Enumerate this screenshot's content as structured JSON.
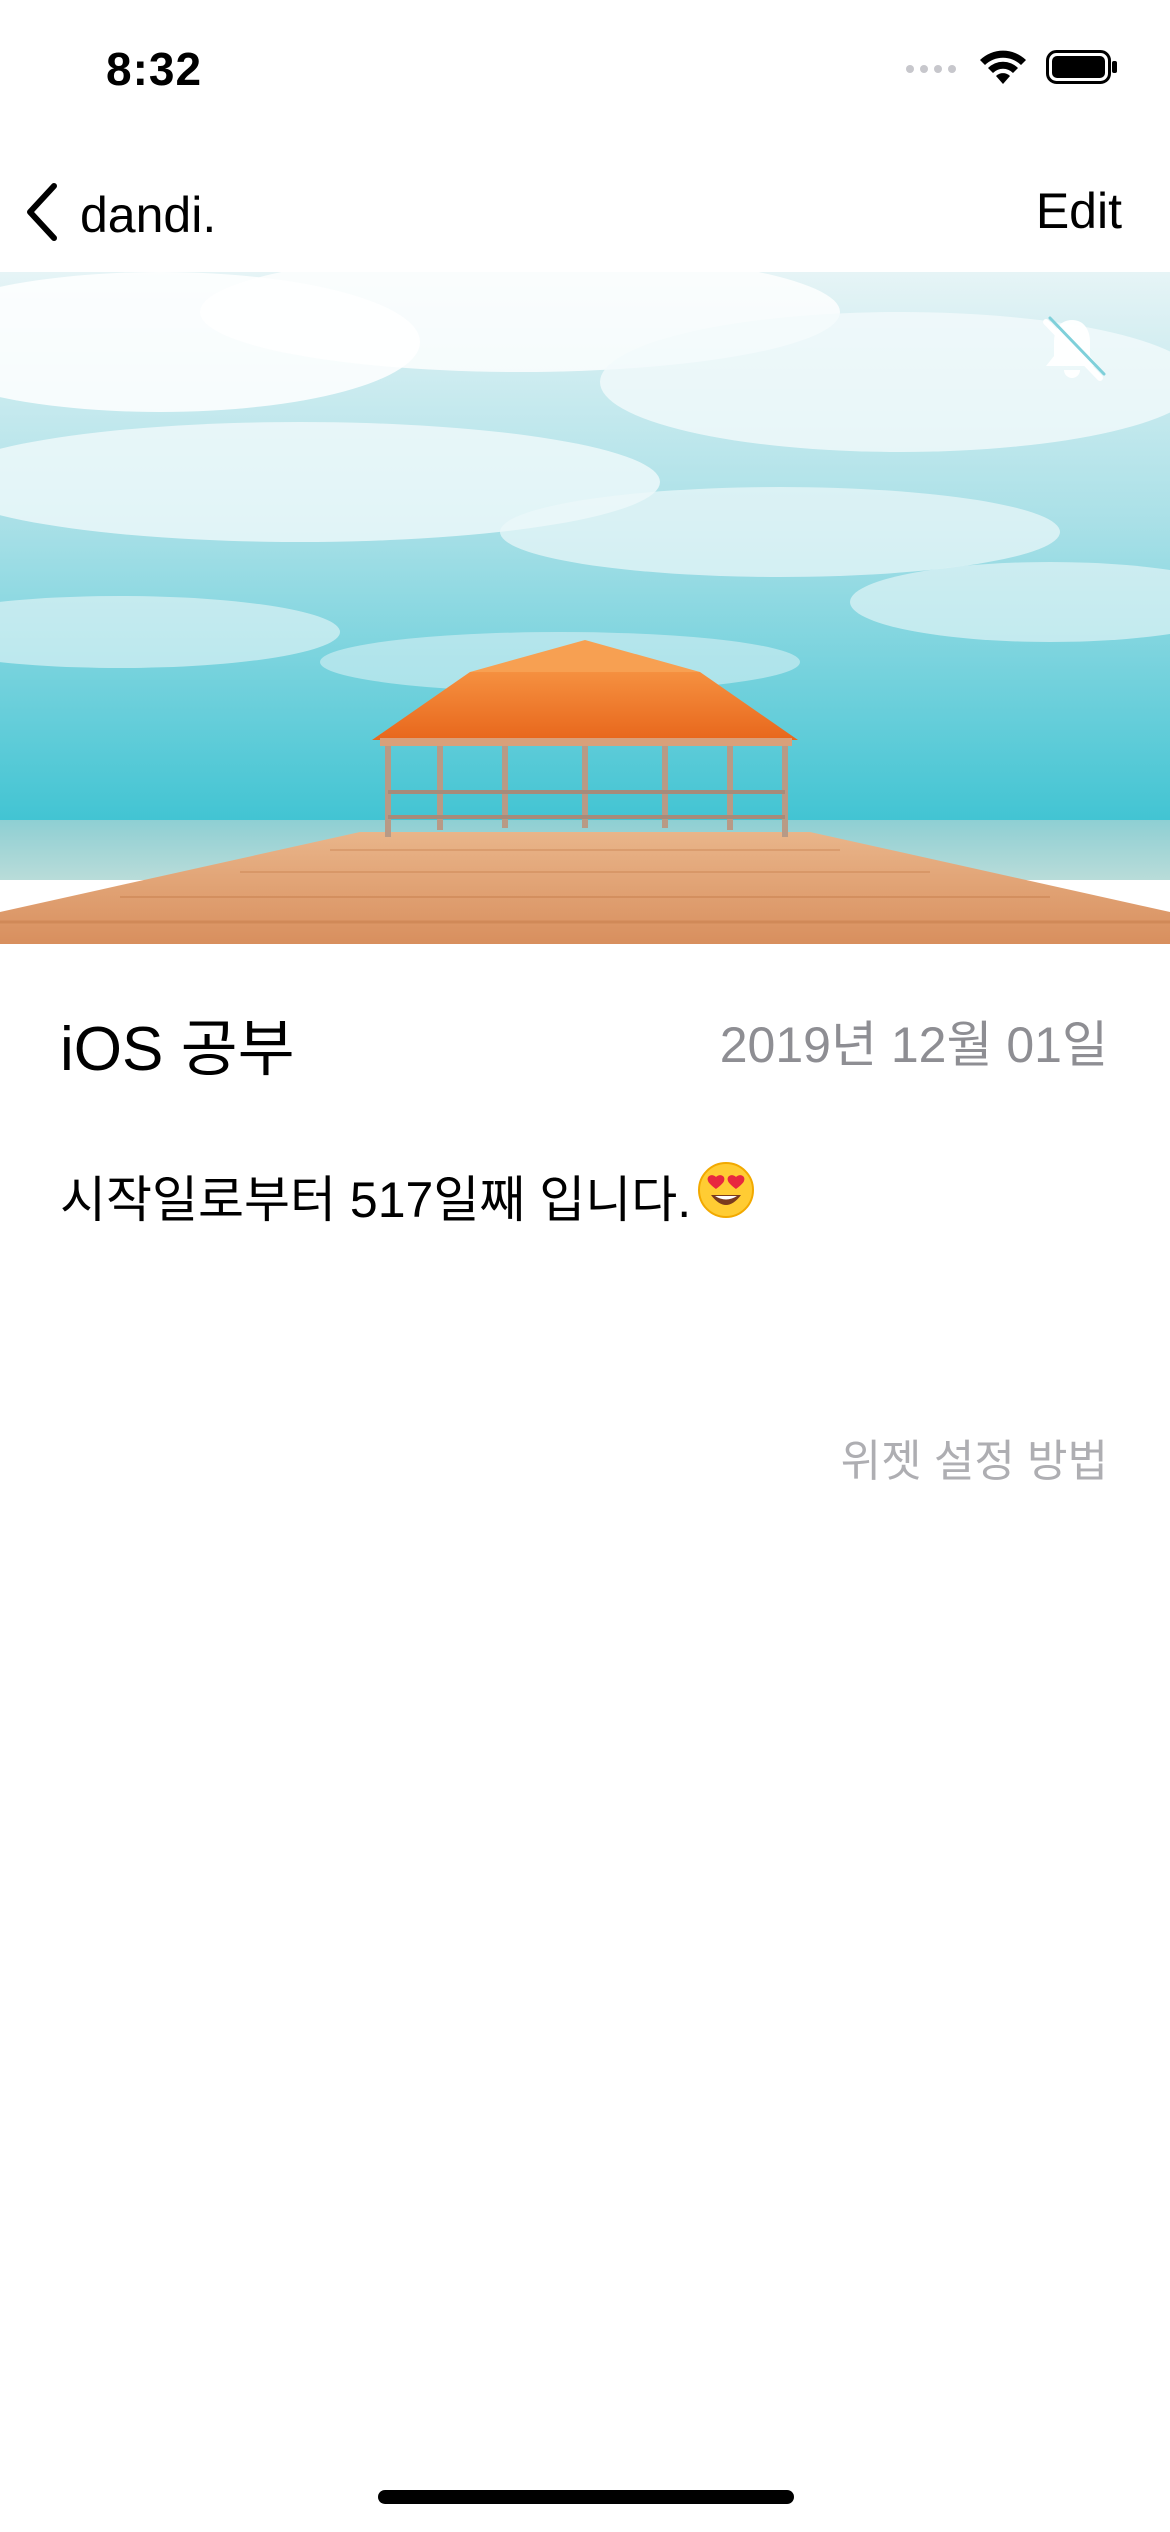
{
  "status_bar": {
    "time": "8:32"
  },
  "nav": {
    "back_label": "dandi.",
    "edit_label": "Edit"
  },
  "hero": {
    "notification_icon": "bell-slash-icon",
    "colors": {
      "sky": "#4dc9d6",
      "roof": "#f07a2a",
      "deck": "#e0a274"
    }
  },
  "detail": {
    "title": "iOS 공부",
    "date": "2019년 12월 01일",
    "message": "시작일로부터 517일째 입니다.",
    "message_emoji": "😍",
    "widget_link": "위젯 설정 방법"
  }
}
